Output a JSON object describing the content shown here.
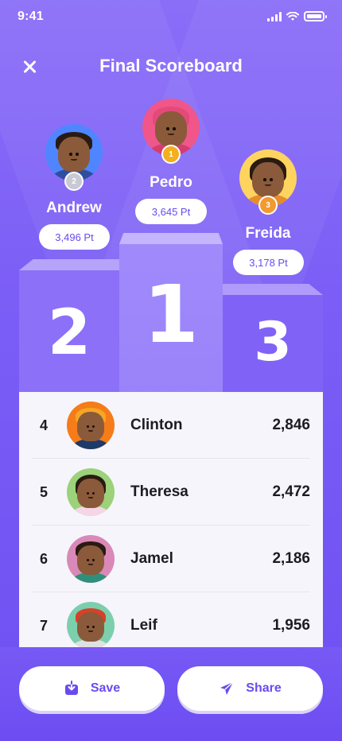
{
  "status_bar": {
    "time": "9:41"
  },
  "header": {
    "title": "Final Scoreboard",
    "close_icon": "close-icon"
  },
  "podium": {
    "first": {
      "rank": "1",
      "name": "Pedro",
      "score": "3,645 Pt",
      "medal_color": "#f2b01e",
      "avatar_bg": "#f0568a",
      "shirt": "#f0568a"
    },
    "second": {
      "rank": "2",
      "name": "Andrew",
      "score": "3,496 Pt",
      "medal_color": "#c9c9d6",
      "avatar_bg": "#4f86ff",
      "shirt": "#2f4e9e"
    },
    "third": {
      "rank": "3",
      "name": "Freida",
      "score": "3,178 Pt",
      "medal_color": "#f29a2e",
      "avatar_bg": "#ffd45e",
      "shirt": "#e68d2b"
    }
  },
  "leaderboard": [
    {
      "rank": "4",
      "name": "Clinton",
      "score": "2,846",
      "avatar_bg": "#f57c18"
    },
    {
      "rank": "5",
      "name": "Theresa",
      "score": "2,472",
      "avatar_bg": "#9bd27a"
    },
    {
      "rank": "6",
      "name": "Jamel",
      "score": "2,186",
      "avatar_bg": "#d989b8"
    },
    {
      "rank": "7",
      "name": "Leif",
      "score": "1,956",
      "avatar_bg": "#7ccfad"
    }
  ],
  "actions": {
    "save_label": "Save",
    "save_icon": "download-icon",
    "share_label": "Share",
    "share_icon": "send-icon"
  },
  "colors": {
    "accent": "#6a4bef",
    "background": "#7b5ef6"
  }
}
